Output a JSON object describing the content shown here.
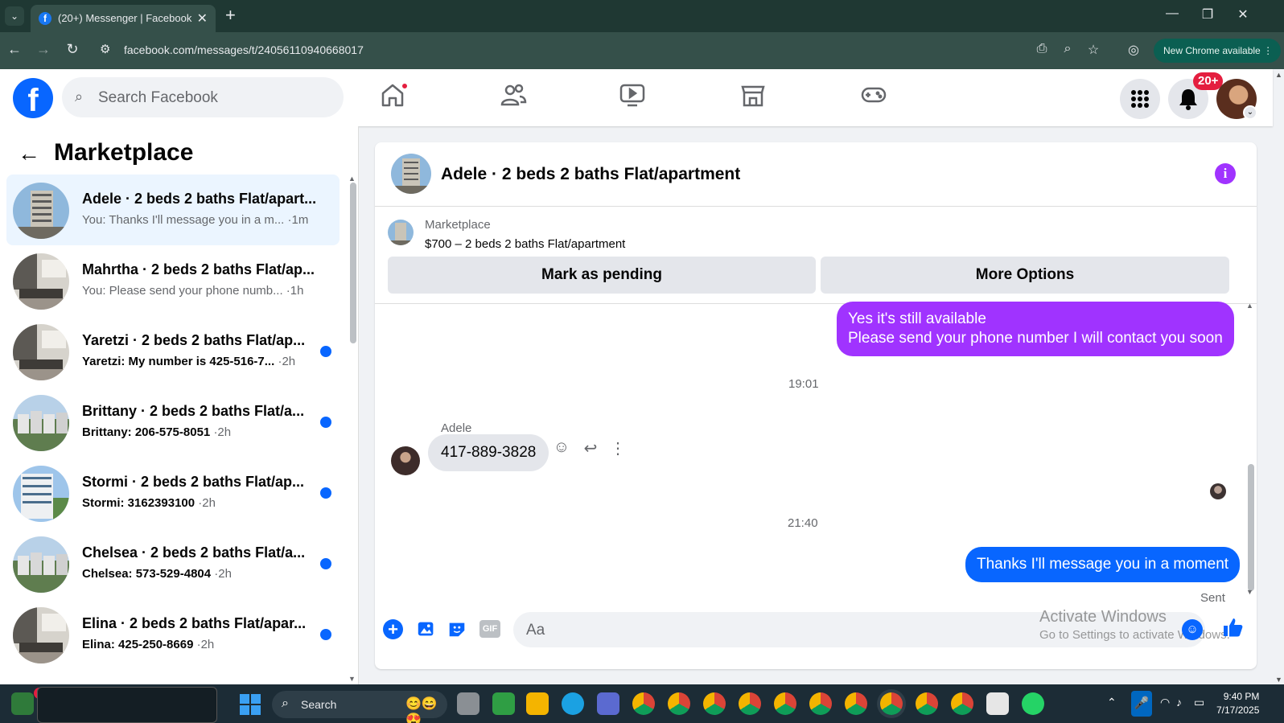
{
  "browser": {
    "tab_title": "(20+) Messenger | Facebook",
    "url": "facebook.com/messages/t/24056110940668017",
    "new_chrome_label": "New Chrome available"
  },
  "header": {
    "search_placeholder": "Search Facebook",
    "notification_badge": "20+"
  },
  "sidebar": {
    "title": "Marketplace",
    "conversations": [
      {
        "title": "Adele · 2 beds 2 baths Flat/apart...",
        "preview": "You: Thanks I'll message you in a m...",
        "time": "·1m",
        "unread": false,
        "active": true
      },
      {
        "title": "Mahrtha · 2 beds 2 baths Flat/ap...",
        "preview": "You: Please send your phone numb...",
        "time": "·1h",
        "unread": false,
        "active": false
      },
      {
        "title": "Yaretzi · 2 beds 2 baths Flat/ap...",
        "preview": "Yaretzi: My number is 425-516-7...",
        "time": "·2h",
        "unread": true,
        "active": false
      },
      {
        "title": "Brittany · 2 beds 2 baths Flat/a...",
        "preview": "Brittany: 206-575-8051",
        "time": "·2h",
        "unread": true,
        "active": false
      },
      {
        "title": "Stormi · 2 beds 2 baths Flat/ap...",
        "preview": "Stormi: 3162393100",
        "time": "·2h",
        "unread": true,
        "active": false
      },
      {
        "title": "Chelsea · 2 beds 2 baths Flat/a...",
        "preview": "Chelsea: 573-529-4804",
        "time": "·2h",
        "unread": true,
        "active": false
      },
      {
        "title": "Elina · 2 beds 2 baths Flat/apar...",
        "preview": "Elina: 425-250-8669",
        "time": "·2h",
        "unread": true,
        "active": false
      }
    ]
  },
  "chat": {
    "title": "Adele · 2 beds 2 baths Flat/apartment",
    "listing_label": "Marketplace",
    "listing_item": "$700 – 2 beds 2 baths Flat/apartment",
    "mark_pending_label": "Mark as pending",
    "more_options_label": "More Options",
    "messages": {
      "out1_line1": "Yes it's still available",
      "out1_line2": "Please send your phone number I will contact you soon",
      "time1": "19:01",
      "sender": "Adele",
      "in1": "417-889-3828",
      "time2": "21:40",
      "out2": "Thanks I'll message you in a moment",
      "status": "Sent"
    },
    "composer_placeholder": "Aa",
    "watermark_line1": "Activate Windows",
    "watermark_line2": "Go to Settings to activate Windows."
  },
  "taskbar": {
    "search_label": "Search",
    "time": "9:40 PM",
    "date": "7/17/2025"
  },
  "colors": {
    "fb_blue": "#0866ff",
    "purple_bubble": "#a033ff",
    "blue_bubble": "#0866ff"
  }
}
